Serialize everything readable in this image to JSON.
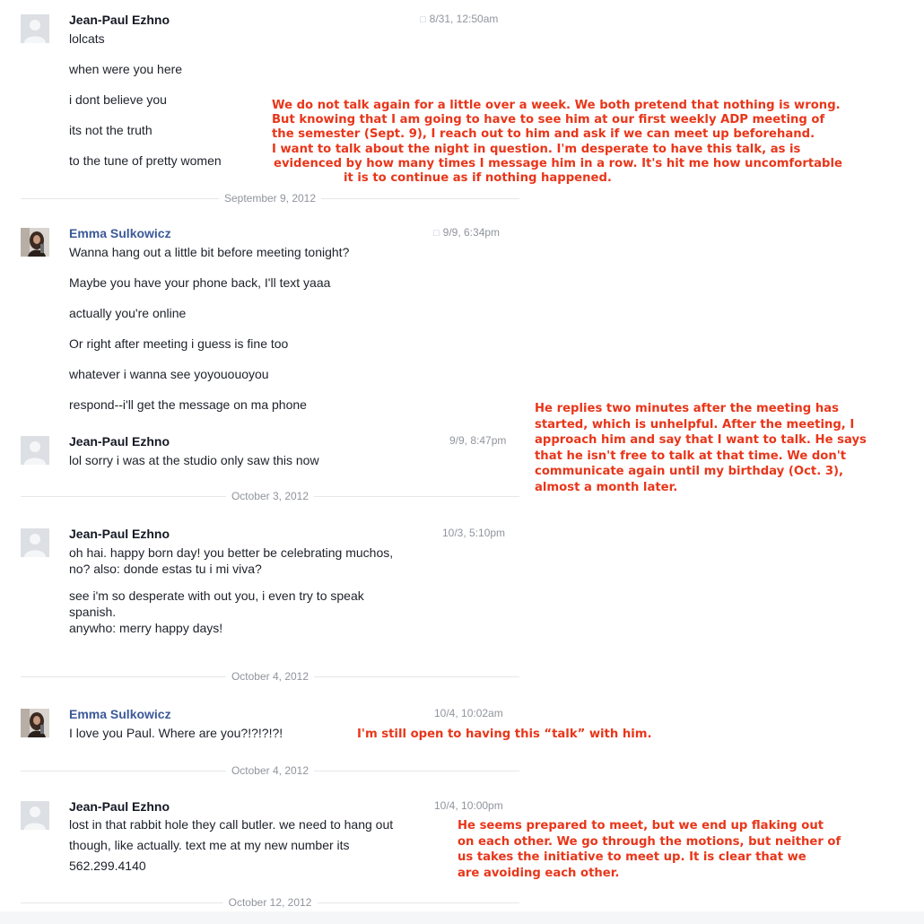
{
  "conversation": [
    {
      "sender": "Jean-Paul Ezhno",
      "avatar": "default-avatar",
      "timestamp": "8/31, 12:50am",
      "has_reply_icon": true,
      "messages": [
        "lolcats",
        "when were you here",
        "i dont believe you",
        "its not the truth",
        "to the tune of pretty women"
      ]
    },
    {
      "divider": "September 9, 2012"
    },
    {
      "sender": "Emma Sulkowicz",
      "avatar": "emma-photo-avatar",
      "timestamp": "9/9, 6:34pm",
      "has_reply_icon": true,
      "messages": [
        "Wanna hang out a little bit before meeting tonight?",
        "Maybe you have your phone back, I'll text yaaa",
        "actually you're online",
        "Or right after meeting i guess is fine too",
        "whatever i wanna see yoyououoyou",
        "respond--i'll get the message on ma phone"
      ]
    },
    {
      "sender": "Jean-Paul Ezhno",
      "avatar": "default-avatar",
      "timestamp": "9/9, 8:47pm",
      "messages": [
        "lol sorry i was at the studio only saw this now"
      ]
    },
    {
      "divider": "October 3, 2012"
    },
    {
      "sender": "Jean-Paul Ezhno",
      "avatar": "default-avatar",
      "timestamp": "10/3, 5:10pm",
      "messages": [
        "oh hai. happy born day! you better be celebrating muchos,\nno? also: donde estas tu i mi viva?",
        "see i'm so desperate with out you, i even try to speak\nspanish.\nanywho: merry happy days!"
      ]
    },
    {
      "divider": "October 4, 2012"
    },
    {
      "sender": "Emma Sulkowicz",
      "avatar": "emma-photo-avatar",
      "timestamp": "10/4, 10:02am",
      "messages": [
        "I love you Paul. Where are you?!?!?!?!"
      ]
    },
    {
      "divider": "October 4, 2012"
    },
    {
      "sender": "Jean-Paul Ezhno",
      "avatar": "default-avatar",
      "timestamp": "10/4, 10:00pm",
      "messages": [
        "lost in that rabbit hole they call butler. we need to hang out\nthough, like actually. text me at my new number its\n562.299.4140"
      ]
    },
    {
      "divider": "October 12, 2012"
    }
  ],
  "annotations": [
    {
      "lines": [
        "We do not talk again for a little over a week. We both pretend that nothing is wrong.",
        "But knowing that I am going to have to see him at our first weekly ADP meeting of",
        "the semester (Sept. 9), I reach out to him and ask if we can meet up beforehand.",
        "I want to talk about the night in question. I'm desperate to have this talk, as is",
        "evidenced by how many times I message him in a row. It's hit me how uncomfortable",
        "it is to continue as if nothing happened."
      ]
    },
    {
      "lines": [
        "He replies two minutes after the meeting has",
        "started, which is unhelpful. After the meeting, I",
        "approach him and say that I want to talk. He says",
        "that he isn't free to talk at that time. We don't",
        "communicate again until my birthday (Oct. 3),",
        "almost a month later."
      ]
    },
    {
      "lines": [
        "I'm still open to having this “talk” with him."
      ]
    },
    {
      "lines": [
        "He seems prepared to meet, but we end up flaking out",
        "on each other. We go through the motions, but neither of",
        "us takes the initiative to meet up. It is clear that we",
        "are avoiding each other."
      ]
    }
  ],
  "colors": {
    "annotation": "#e8361a",
    "name_link": "#3b5998",
    "meta": "#90949c"
  }
}
